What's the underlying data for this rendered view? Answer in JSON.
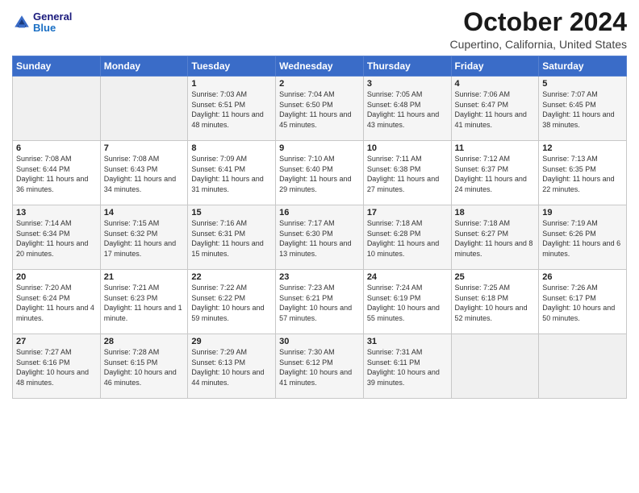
{
  "header": {
    "logo_general": "General",
    "logo_blue": "Blue",
    "month_title": "October 2024",
    "subtitle": "Cupertino, California, United States"
  },
  "weekdays": [
    "Sunday",
    "Monday",
    "Tuesday",
    "Wednesday",
    "Thursday",
    "Friday",
    "Saturday"
  ],
  "weeks": [
    [
      {
        "day": "",
        "sunrise": "",
        "sunset": "",
        "daylight": "",
        "empty": true
      },
      {
        "day": "",
        "sunrise": "",
        "sunset": "",
        "daylight": "",
        "empty": true
      },
      {
        "day": "1",
        "sunrise": "Sunrise: 7:03 AM",
        "sunset": "Sunset: 6:51 PM",
        "daylight": "Daylight: 11 hours and 48 minutes.",
        "empty": false
      },
      {
        "day": "2",
        "sunrise": "Sunrise: 7:04 AM",
        "sunset": "Sunset: 6:50 PM",
        "daylight": "Daylight: 11 hours and 45 minutes.",
        "empty": false
      },
      {
        "day": "3",
        "sunrise": "Sunrise: 7:05 AM",
        "sunset": "Sunset: 6:48 PM",
        "daylight": "Daylight: 11 hours and 43 minutes.",
        "empty": false
      },
      {
        "day": "4",
        "sunrise": "Sunrise: 7:06 AM",
        "sunset": "Sunset: 6:47 PM",
        "daylight": "Daylight: 11 hours and 41 minutes.",
        "empty": false
      },
      {
        "day": "5",
        "sunrise": "Sunrise: 7:07 AM",
        "sunset": "Sunset: 6:45 PM",
        "daylight": "Daylight: 11 hours and 38 minutes.",
        "empty": false
      }
    ],
    [
      {
        "day": "6",
        "sunrise": "Sunrise: 7:08 AM",
        "sunset": "Sunset: 6:44 PM",
        "daylight": "Daylight: 11 hours and 36 minutes.",
        "empty": false
      },
      {
        "day": "7",
        "sunrise": "Sunrise: 7:08 AM",
        "sunset": "Sunset: 6:43 PM",
        "daylight": "Daylight: 11 hours and 34 minutes.",
        "empty": false
      },
      {
        "day": "8",
        "sunrise": "Sunrise: 7:09 AM",
        "sunset": "Sunset: 6:41 PM",
        "daylight": "Daylight: 11 hours and 31 minutes.",
        "empty": false
      },
      {
        "day": "9",
        "sunrise": "Sunrise: 7:10 AM",
        "sunset": "Sunset: 6:40 PM",
        "daylight": "Daylight: 11 hours and 29 minutes.",
        "empty": false
      },
      {
        "day": "10",
        "sunrise": "Sunrise: 7:11 AM",
        "sunset": "Sunset: 6:38 PM",
        "daylight": "Daylight: 11 hours and 27 minutes.",
        "empty": false
      },
      {
        "day": "11",
        "sunrise": "Sunrise: 7:12 AM",
        "sunset": "Sunset: 6:37 PM",
        "daylight": "Daylight: 11 hours and 24 minutes.",
        "empty": false
      },
      {
        "day": "12",
        "sunrise": "Sunrise: 7:13 AM",
        "sunset": "Sunset: 6:35 PM",
        "daylight": "Daylight: 11 hours and 22 minutes.",
        "empty": false
      }
    ],
    [
      {
        "day": "13",
        "sunrise": "Sunrise: 7:14 AM",
        "sunset": "Sunset: 6:34 PM",
        "daylight": "Daylight: 11 hours and 20 minutes.",
        "empty": false
      },
      {
        "day": "14",
        "sunrise": "Sunrise: 7:15 AM",
        "sunset": "Sunset: 6:32 PM",
        "daylight": "Daylight: 11 hours and 17 minutes.",
        "empty": false
      },
      {
        "day": "15",
        "sunrise": "Sunrise: 7:16 AM",
        "sunset": "Sunset: 6:31 PM",
        "daylight": "Daylight: 11 hours and 15 minutes.",
        "empty": false
      },
      {
        "day": "16",
        "sunrise": "Sunrise: 7:17 AM",
        "sunset": "Sunset: 6:30 PM",
        "daylight": "Daylight: 11 hours and 13 minutes.",
        "empty": false
      },
      {
        "day": "17",
        "sunrise": "Sunrise: 7:18 AM",
        "sunset": "Sunset: 6:28 PM",
        "daylight": "Daylight: 11 hours and 10 minutes.",
        "empty": false
      },
      {
        "day": "18",
        "sunrise": "Sunrise: 7:18 AM",
        "sunset": "Sunset: 6:27 PM",
        "daylight": "Daylight: 11 hours and 8 minutes.",
        "empty": false
      },
      {
        "day": "19",
        "sunrise": "Sunrise: 7:19 AM",
        "sunset": "Sunset: 6:26 PM",
        "daylight": "Daylight: 11 hours and 6 minutes.",
        "empty": false
      }
    ],
    [
      {
        "day": "20",
        "sunrise": "Sunrise: 7:20 AM",
        "sunset": "Sunset: 6:24 PM",
        "daylight": "Daylight: 11 hours and 4 minutes.",
        "empty": false
      },
      {
        "day": "21",
        "sunrise": "Sunrise: 7:21 AM",
        "sunset": "Sunset: 6:23 PM",
        "daylight": "Daylight: 11 hours and 1 minute.",
        "empty": false
      },
      {
        "day": "22",
        "sunrise": "Sunrise: 7:22 AM",
        "sunset": "Sunset: 6:22 PM",
        "daylight": "Daylight: 10 hours and 59 minutes.",
        "empty": false
      },
      {
        "day": "23",
        "sunrise": "Sunrise: 7:23 AM",
        "sunset": "Sunset: 6:21 PM",
        "daylight": "Daylight: 10 hours and 57 minutes.",
        "empty": false
      },
      {
        "day": "24",
        "sunrise": "Sunrise: 7:24 AM",
        "sunset": "Sunset: 6:19 PM",
        "daylight": "Daylight: 10 hours and 55 minutes.",
        "empty": false
      },
      {
        "day": "25",
        "sunrise": "Sunrise: 7:25 AM",
        "sunset": "Sunset: 6:18 PM",
        "daylight": "Daylight: 10 hours and 52 minutes.",
        "empty": false
      },
      {
        "day": "26",
        "sunrise": "Sunrise: 7:26 AM",
        "sunset": "Sunset: 6:17 PM",
        "daylight": "Daylight: 10 hours and 50 minutes.",
        "empty": false
      }
    ],
    [
      {
        "day": "27",
        "sunrise": "Sunrise: 7:27 AM",
        "sunset": "Sunset: 6:16 PM",
        "daylight": "Daylight: 10 hours and 48 minutes.",
        "empty": false
      },
      {
        "day": "28",
        "sunrise": "Sunrise: 7:28 AM",
        "sunset": "Sunset: 6:15 PM",
        "daylight": "Daylight: 10 hours and 46 minutes.",
        "empty": false
      },
      {
        "day": "29",
        "sunrise": "Sunrise: 7:29 AM",
        "sunset": "Sunset: 6:13 PM",
        "daylight": "Daylight: 10 hours and 44 minutes.",
        "empty": false
      },
      {
        "day": "30",
        "sunrise": "Sunrise: 7:30 AM",
        "sunset": "Sunset: 6:12 PM",
        "daylight": "Daylight: 10 hours and 41 minutes.",
        "empty": false
      },
      {
        "day": "31",
        "sunrise": "Sunrise: 7:31 AM",
        "sunset": "Sunset: 6:11 PM",
        "daylight": "Daylight: 10 hours and 39 minutes.",
        "empty": false
      },
      {
        "day": "",
        "sunrise": "",
        "sunset": "",
        "daylight": "",
        "empty": true
      },
      {
        "day": "",
        "sunrise": "",
        "sunset": "",
        "daylight": "",
        "empty": true
      }
    ]
  ]
}
